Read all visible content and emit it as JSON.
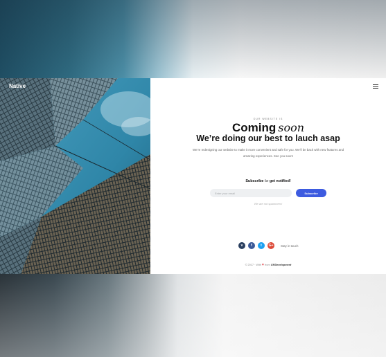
{
  "brand": {
    "name": "Native"
  },
  "hero": {
    "eyebrow": "Our website is",
    "title_main": "Coming",
    "title_script": "soon",
    "subtitle": "We’re doing our best to lauch asap",
    "description": "We’re redesigning our website to make it more convenient and safe for you. We’ll be back with new features and amazing experiences. See you soon!"
  },
  "subscribe": {
    "title_pre": "Subscribe",
    "title_script": "to",
    "title_post": "get notified!",
    "input_placeholder": "Enter your email",
    "button_label": "Subscribe",
    "note": "We are not spammers!"
  },
  "social": {
    "items": [
      {
        "name": "vimeo",
        "glyph": "v",
        "color": "#2a3f5f"
      },
      {
        "name": "facebook",
        "glyph": "f",
        "color": "#3b5998"
      },
      {
        "name": "twitter",
        "glyph": "t",
        "color": "#1da1f2"
      },
      {
        "name": "google-plus",
        "glyph": "G+",
        "color": "#dd4b39"
      }
    ],
    "stay_label": "Stay in touch"
  },
  "footer": {
    "copyright": "© 2017 · With",
    "heart_icon": "heart-icon",
    "from": "from",
    "author": "GRDevelopment"
  },
  "colors": {
    "accent": "#3d5be0",
    "heart": "#e0454b"
  }
}
